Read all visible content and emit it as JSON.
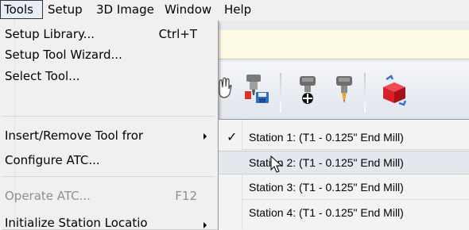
{
  "menubar": {
    "items": [
      {
        "label": "Tools"
      },
      {
        "label": "Setup"
      },
      {
        "label": "3D Image"
      },
      {
        "label": "Window"
      },
      {
        "label": "Help"
      }
    ]
  },
  "tools_menu": {
    "items": [
      {
        "label": "Setup Library...",
        "shortcut": "Ctrl+T"
      },
      {
        "label": "Setup Tool Wizard..."
      },
      {
        "label": "Select Tool..."
      },
      {
        "label": "Insert/Remove Tool fror"
      },
      {
        "label": "Configure ATC..."
      },
      {
        "label": "Operate ATC...",
        "shortcut": "F12"
      },
      {
        "label": "Initialize Station Locatio"
      }
    ]
  },
  "submenu": {
    "items": [
      {
        "label": "Station 1: (T1 - 0.125\" End Mill)",
        "checked": "✓"
      },
      {
        "label": "Station 2: (T1 - 0.125\" End Mill)"
      },
      {
        "label": "Station 3: (T1 - 0.125\" End Mill)"
      },
      {
        "label": "Station 4: (T1 - 0.125\" End Mill)"
      }
    ]
  },
  "toolbar": {
    "icons": [
      "hand-icon",
      "tool-save-icon",
      "spindle-tool-icon",
      "tool-change-icon",
      "3d-cube-icon"
    ]
  },
  "colors": {
    "menu_bg": "#f0f0f0",
    "highlight": "#d9e4f4",
    "cube_red": "#d81e2b"
  }
}
